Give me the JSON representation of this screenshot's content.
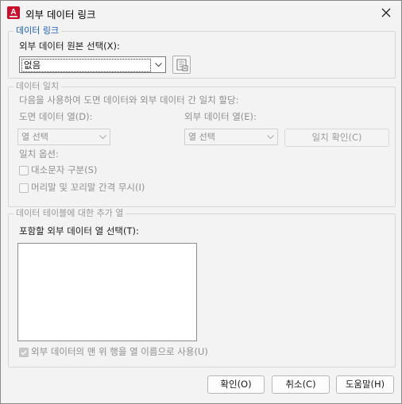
{
  "window": {
    "title": "외부 데이터 링크"
  },
  "data_link": {
    "legend": "데이터 링크",
    "source_label": "외부 데이터 원본 선택(X):",
    "source_value": "없음"
  },
  "match": {
    "legend": "데이터 일치",
    "description": "다음을 사용하여 도면 데이터와 외부 데이터 간 일치 할당:",
    "drawing_col_label": "도면 데이터 열(D):",
    "drawing_col_value": "열 선택",
    "external_col_label": "외부 데이터 열(E):",
    "external_col_value": "열 선택",
    "check_button": "일치 확인(C)",
    "options_label": "일치 옵션:",
    "case_sensitive": "대소문자 구분(S)",
    "ignore_spaces": "머리말 및 꼬리말 간격 무시(I)"
  },
  "extra": {
    "legend": "데이터 테이블에 대한 추가 열",
    "select_label": "포함할 외부 데이터 열 선택(T):",
    "use_first_row": "외부 데이터의 맨 위 행을 열 이름으로 사용(U)",
    "use_first_row_checked": true
  },
  "buttons": {
    "ok": "확인(O)",
    "cancel": "취소(C)",
    "help": "도움말(H)"
  },
  "icons": {
    "app": "autocad-app-icon",
    "close": "close-icon",
    "link": "data-link-manager-icon",
    "arrow": "chevron-down-icon"
  }
}
